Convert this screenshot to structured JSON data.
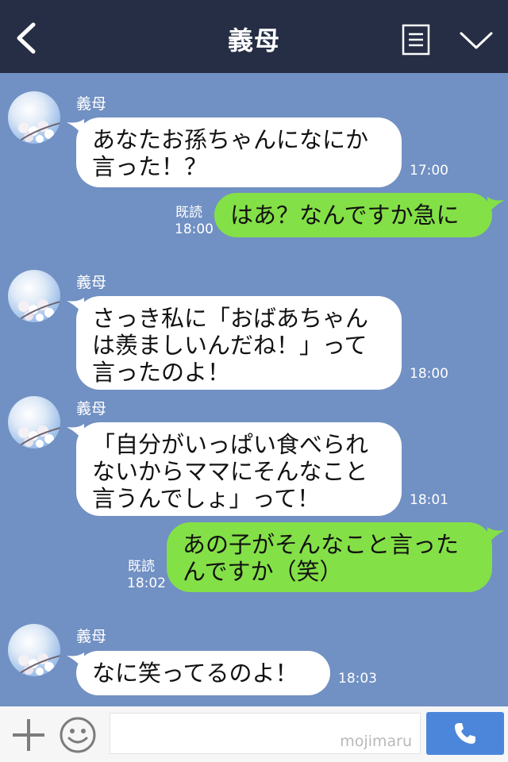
{
  "header": {
    "title": "義母"
  },
  "messages": [
    {
      "sender": "義母",
      "text": "あなたお孫ちゃんになにか言った！？",
      "time": "17:00"
    },
    {
      "text": "はあ？なんですか急に",
      "read": "既読",
      "time": "18:00"
    },
    {
      "sender": "義母",
      "text": "さっき私に「おばあちゃんは羨ましいんだね！」って言ったのよ！",
      "time": "18:00"
    },
    {
      "sender": "義母",
      "text": "「自分がいっぱい食べられないからママにそんなこと言うんでしょ」って！",
      "time": "18:01"
    },
    {
      "text": "あの子がそんなこと言ったんですか（笑）",
      "read": "既読",
      "time": "18:02"
    },
    {
      "sender": "義母",
      "text": "なに笑ってるのよ！",
      "time": "18:03"
    }
  ],
  "input": {
    "watermark": "mojimaru"
  },
  "icons": {
    "back": "chevron-left-icon",
    "menu": "notes-icon",
    "collapse": "chevron-down-icon",
    "plus": "plus-icon",
    "emoji": "smiley-icon",
    "call": "phone-icon"
  },
  "colors": {
    "header_bg": "#262e45",
    "chat_bg": "#7190c3",
    "incoming_bubble": "#ffffff",
    "outgoing_bubble": "#84e047",
    "call_button": "#4b86db"
  }
}
